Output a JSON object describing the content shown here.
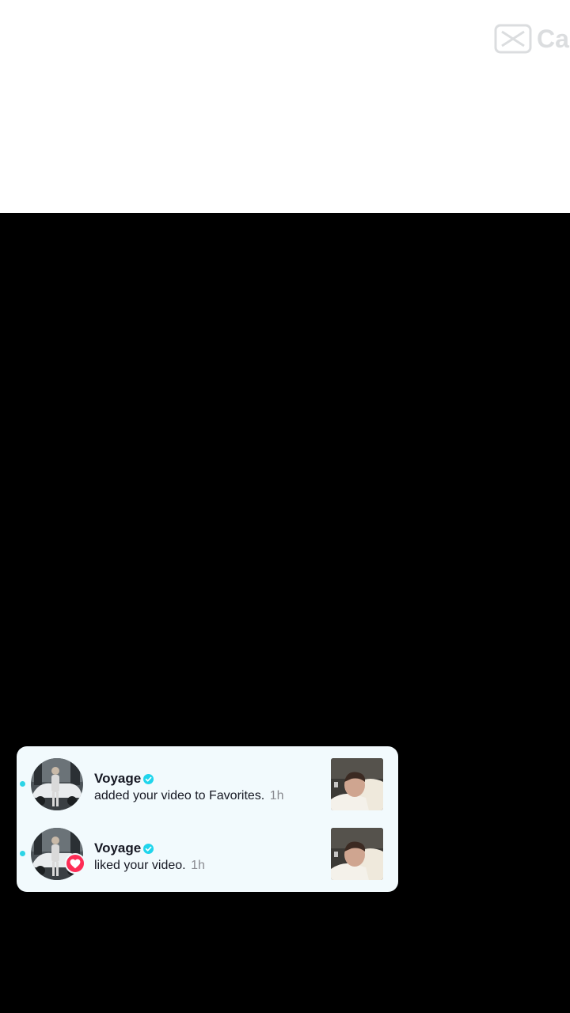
{
  "watermark": {
    "icon": "capcut-logo-icon",
    "text": "Ca"
  },
  "notifications": [
    {
      "username": "Voyage",
      "action": "added your video to Favorites.",
      "time": "1h",
      "badge": null
    },
    {
      "username": "Voyage",
      "action": "liked your video.",
      "time": "1h",
      "badge": "heart-icon"
    }
  ],
  "colors": {
    "card_background": "#f2fafd",
    "verified": "#20d5ec",
    "unread_dot": "#2dd4e6",
    "heart_badge": "#fe2c55",
    "username": "#161823",
    "time": "#8a8b91"
  }
}
